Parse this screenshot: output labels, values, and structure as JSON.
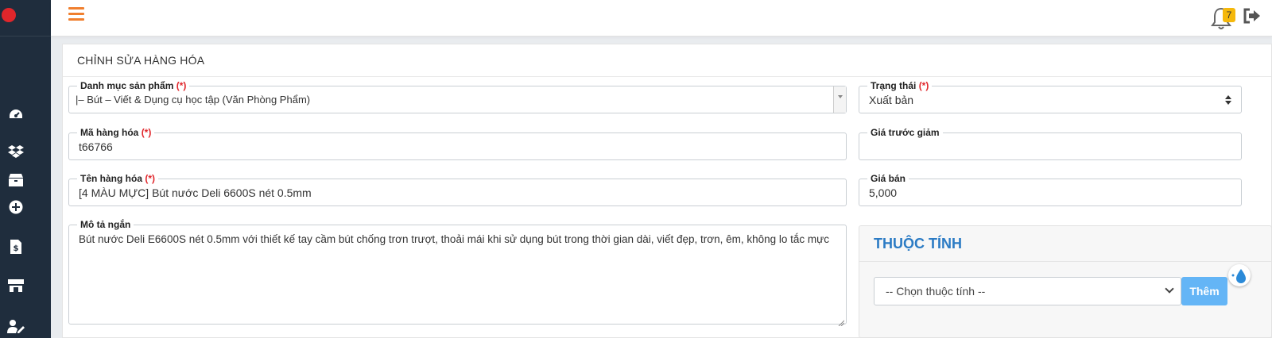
{
  "header": {
    "notification_count": "7"
  },
  "sidebar": {
    "items": [
      {
        "icon": "dashboard-icon"
      },
      {
        "icon": "dropbox-icon"
      },
      {
        "icon": "box-icon"
      },
      {
        "icon": "plus-circle-icon"
      },
      {
        "icon": "invoice-icon"
      },
      {
        "icon": "store-icon"
      },
      {
        "icon": "user-edit-icon"
      }
    ]
  },
  "form": {
    "title": "CHỈNH SỬA HÀNG HÓA",
    "required_mark": "(*)",
    "category": {
      "label": "Danh mục sản phẩm",
      "value": "|– Bút – Viết & Dụng cụ học tập (Văn Phòng Phẩm)"
    },
    "status": {
      "label": "Trạng thái",
      "value": "Xuất bản"
    },
    "sku": {
      "label": "Mã hàng hóa",
      "value": "t66766"
    },
    "price_before": {
      "label": "Giá trước giảm",
      "value": ""
    },
    "name": {
      "label": "Tên hàng hóa",
      "value": "[4 MÀU MỰC] Bút nước Deli 6600S nét 0.5mm"
    },
    "price": {
      "label": "Giá bán",
      "value": "5,000"
    },
    "short_desc": {
      "label": "Mô tả ngắn",
      "value": "Bút nước Deli E6600S nét 0.5mm với thiết kế tay cầm bút chống trơn trượt, thoải mái khi sử dụng bút trong thời gian dài, viết đẹp, trơn, êm, không lo tắc mực"
    }
  },
  "attributes": {
    "title": "THUỘC TÍNH",
    "select_value": "-- Chọn thuộc tính --",
    "add_label": "Thêm"
  },
  "colors": {
    "accent": "#f07f2e",
    "sidebar": "#1f2d3d",
    "link_blue": "#2b7bc4",
    "button_blue": "#64b5f6",
    "required": "#e0262b"
  }
}
